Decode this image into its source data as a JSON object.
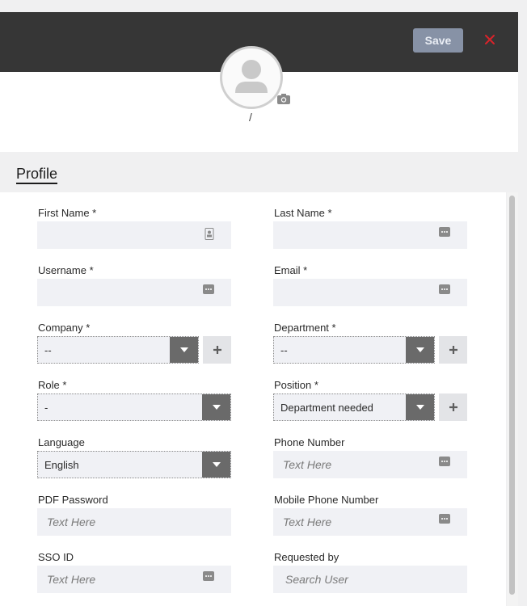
{
  "header": {
    "save_label": "Save",
    "close_symbol": "✕",
    "accent_save": "#8792a6",
    "close_color": "#d9232a"
  },
  "avatar": {
    "caption": "/"
  },
  "section": {
    "title": "Profile"
  },
  "form": {
    "first_name": {
      "label": "First Name *"
    },
    "last_name": {
      "label": "Last Name *"
    },
    "username": {
      "label": "Username *"
    },
    "email": {
      "label": "Email *"
    },
    "company": {
      "label": "Company *",
      "value": "--"
    },
    "department": {
      "label": "Department *",
      "value": "--"
    },
    "role": {
      "label": "Role *",
      "value": "-"
    },
    "position": {
      "label": "Position *",
      "value": "Department needed"
    },
    "language": {
      "label": "Language",
      "value": "English"
    },
    "phone": {
      "label": "Phone Number",
      "placeholder": "Text Here"
    },
    "pdf_password": {
      "label": "PDF Password",
      "placeholder": "Text Here"
    },
    "mobile": {
      "label": "Mobile Phone Number",
      "placeholder": "Text Here"
    },
    "sso": {
      "label": "SSO ID",
      "placeholder": "Text Here"
    },
    "requested_by": {
      "label": "Requested by",
      "placeholder": "Search User"
    }
  }
}
